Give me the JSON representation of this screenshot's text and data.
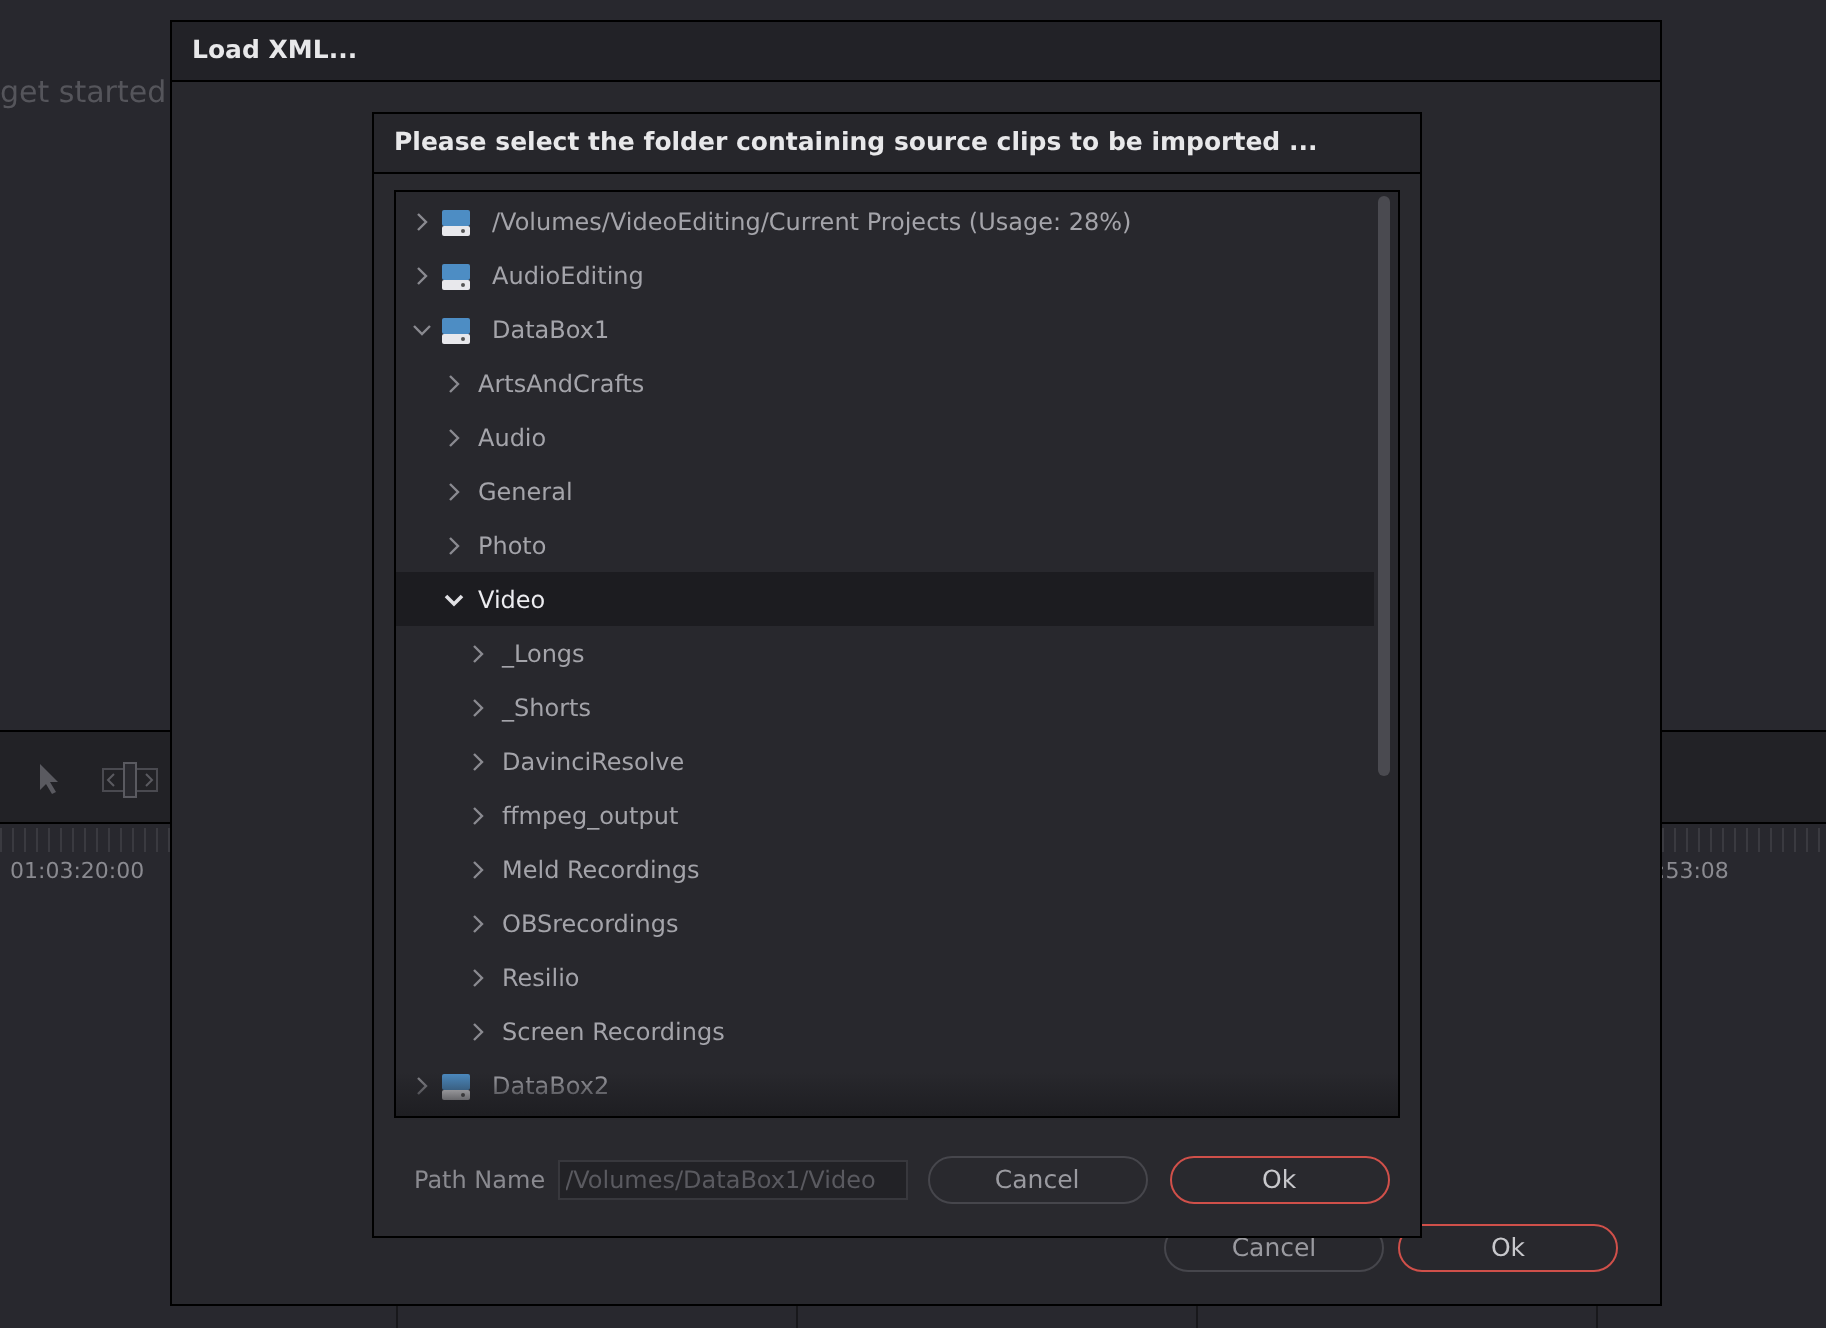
{
  "background": {
    "hint": "get started",
    "timecode_left": "01:03:20:00",
    "timecode_right": ":53:08"
  },
  "load_dialog": {
    "title": "Load XML...",
    "buttons": [
      {
        "label": "Cancel",
        "kind": "plain"
      },
      {
        "label": "Ok",
        "kind": "primary"
      }
    ]
  },
  "folder_dialog": {
    "title": "Please select the folder containing source clips to be imported ...",
    "tree": [
      {
        "label": "/Volumes/VideoEditing/Current Projects (Usage: 28%)",
        "kind": "drive",
        "expanded": false,
        "selected": false
      },
      {
        "label": "AudioEditing",
        "kind": "drive",
        "expanded": false,
        "selected": false
      },
      {
        "label": "DataBox1",
        "kind": "drive",
        "expanded": true,
        "selected": false,
        "children": [
          {
            "label": "ArtsAndCrafts",
            "kind": "folder",
            "expanded": false,
            "selected": false
          },
          {
            "label": "Audio",
            "kind": "folder",
            "expanded": false,
            "selected": false
          },
          {
            "label": "General",
            "kind": "folder",
            "expanded": false,
            "selected": false
          },
          {
            "label": "Photo",
            "kind": "folder",
            "expanded": false,
            "selected": false
          },
          {
            "label": "Video",
            "kind": "folder",
            "expanded": true,
            "selected": true,
            "children": [
              {
                "label": "_Longs",
                "kind": "folder",
                "expanded": false,
                "selected": false
              },
              {
                "label": "_Shorts",
                "kind": "folder",
                "expanded": false,
                "selected": false
              },
              {
                "label": "DavinciResolve",
                "kind": "folder",
                "expanded": false,
                "selected": false
              },
              {
                "label": "ffmpeg_output",
                "kind": "folder",
                "expanded": false,
                "selected": false
              },
              {
                "label": "Meld Recordings",
                "kind": "folder",
                "expanded": false,
                "selected": false
              },
              {
                "label": "OBSrecordings",
                "kind": "folder",
                "expanded": false,
                "selected": false
              },
              {
                "label": "Resilio",
                "kind": "folder",
                "expanded": false,
                "selected": false
              },
              {
                "label": "Screen Recordings",
                "kind": "folder",
                "expanded": false,
                "selected": false
              }
            ]
          }
        ]
      },
      {
        "label": "DataBox2",
        "kind": "drive",
        "expanded": false,
        "selected": false
      }
    ],
    "path_label": "Path Name",
    "path_value": "/Volumes/DataBox1/Video",
    "buttons": [
      {
        "label": "Cancel",
        "kind": "plain"
      },
      {
        "label": "Ok",
        "kind": "primary"
      }
    ]
  }
}
